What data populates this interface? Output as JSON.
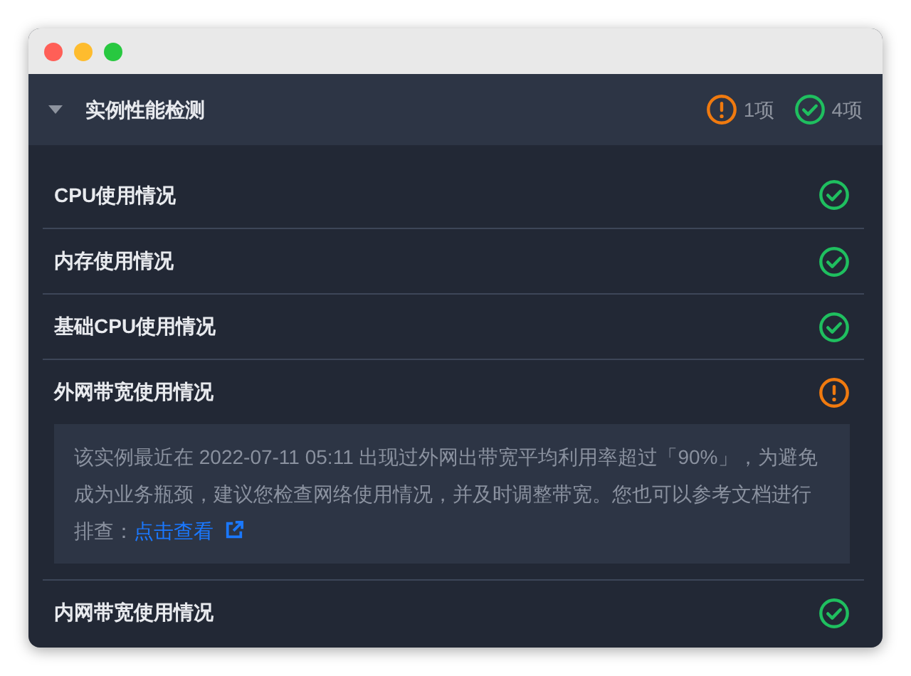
{
  "window": {
    "controls": [
      {
        "color": "#ff5f57"
      },
      {
        "color": "#febc2e"
      },
      {
        "color": "#28c840"
      }
    ]
  },
  "section": {
    "title": "实例性能检测",
    "expanded": true,
    "summary": [
      {
        "kind": "warning",
        "count": "1项"
      },
      {
        "kind": "ok",
        "count": "4项"
      }
    ],
    "items": [
      {
        "label": "CPU使用情况",
        "kind": "ok"
      },
      {
        "label": "内存使用情况",
        "kind": "ok"
      },
      {
        "label": "基础CPU使用情况",
        "kind": "ok"
      },
      {
        "label": "外网带宽使用情况",
        "kind": "warning",
        "detail": {
          "text": "该实例最近在 2022-07-11 05:11 出现过外网出带宽平均利用率超过「90%」，为避免成为业务瓶颈，建议您检查网络使用情况，并及时调整带宽。您也可以参考文档进行排查：",
          "link": "点击查看"
        }
      },
      {
        "label": "内网带宽使用情况",
        "kind": "ok"
      }
    ]
  }
}
